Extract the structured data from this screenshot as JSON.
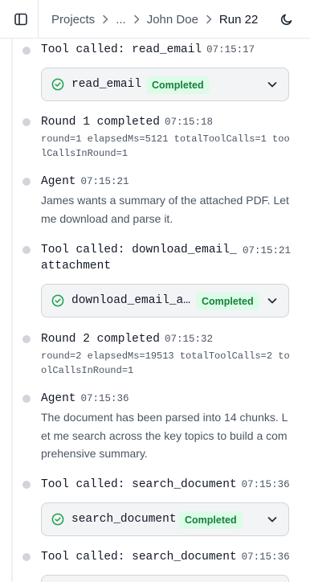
{
  "header": {
    "breadcrumb": [
      "Projects",
      "...",
      "John Doe",
      "Run 22"
    ]
  },
  "entries": [
    {
      "kind": "tool",
      "title": "Tool called: read_email",
      "time": "07:15:17",
      "card": {
        "name": "read_email",
        "status": "Completed"
      }
    },
    {
      "kind": "round",
      "title": "Round 1 completed",
      "time": "07:15:18",
      "meta": "round=1  elapsedMs=5121  totalToolCalls=1 toolCallsInRound=1"
    },
    {
      "kind": "agent",
      "title": "Agent",
      "time": "07:15:21",
      "text": "James wants a summary of the attached PDF. Let me download and parse it."
    },
    {
      "kind": "tool",
      "title_line1": "Tool called: download_email_",
      "title_line2": "attachment",
      "time": "07:15:21",
      "card": {
        "name": "download_email_a…",
        "status": "Completed"
      }
    },
    {
      "kind": "round",
      "title": "Round 2 completed",
      "time": "07:15:32",
      "meta": "round=2  elapsedMs=19513  totalToolCalls=2 toolCallsInRound=1"
    },
    {
      "kind": "agent",
      "title": "Agent",
      "time": "07:15:36",
      "text": "The document has been parsed into 14 chunks. Let me search across the key topics to build a comprehensive summary."
    },
    {
      "kind": "tool",
      "title": "Tool called: search_document",
      "time": "07:15:36",
      "card": {
        "name": "search_document",
        "status": "Completed"
      }
    },
    {
      "kind": "tool",
      "title": "Tool called: search_document",
      "time": "07:15:36"
    }
  ],
  "colors": {
    "badge_bg": "#dcfce7",
    "badge_text": "#15803d",
    "success_icon": "#16a34a",
    "rail": "#eceef2",
    "dot": "#d1d5db"
  },
  "icons": [
    "sidebar-toggle-icon",
    "chevron-right-icon",
    "moon-icon",
    "check-circle-icon",
    "chevron-down-icon"
  ]
}
